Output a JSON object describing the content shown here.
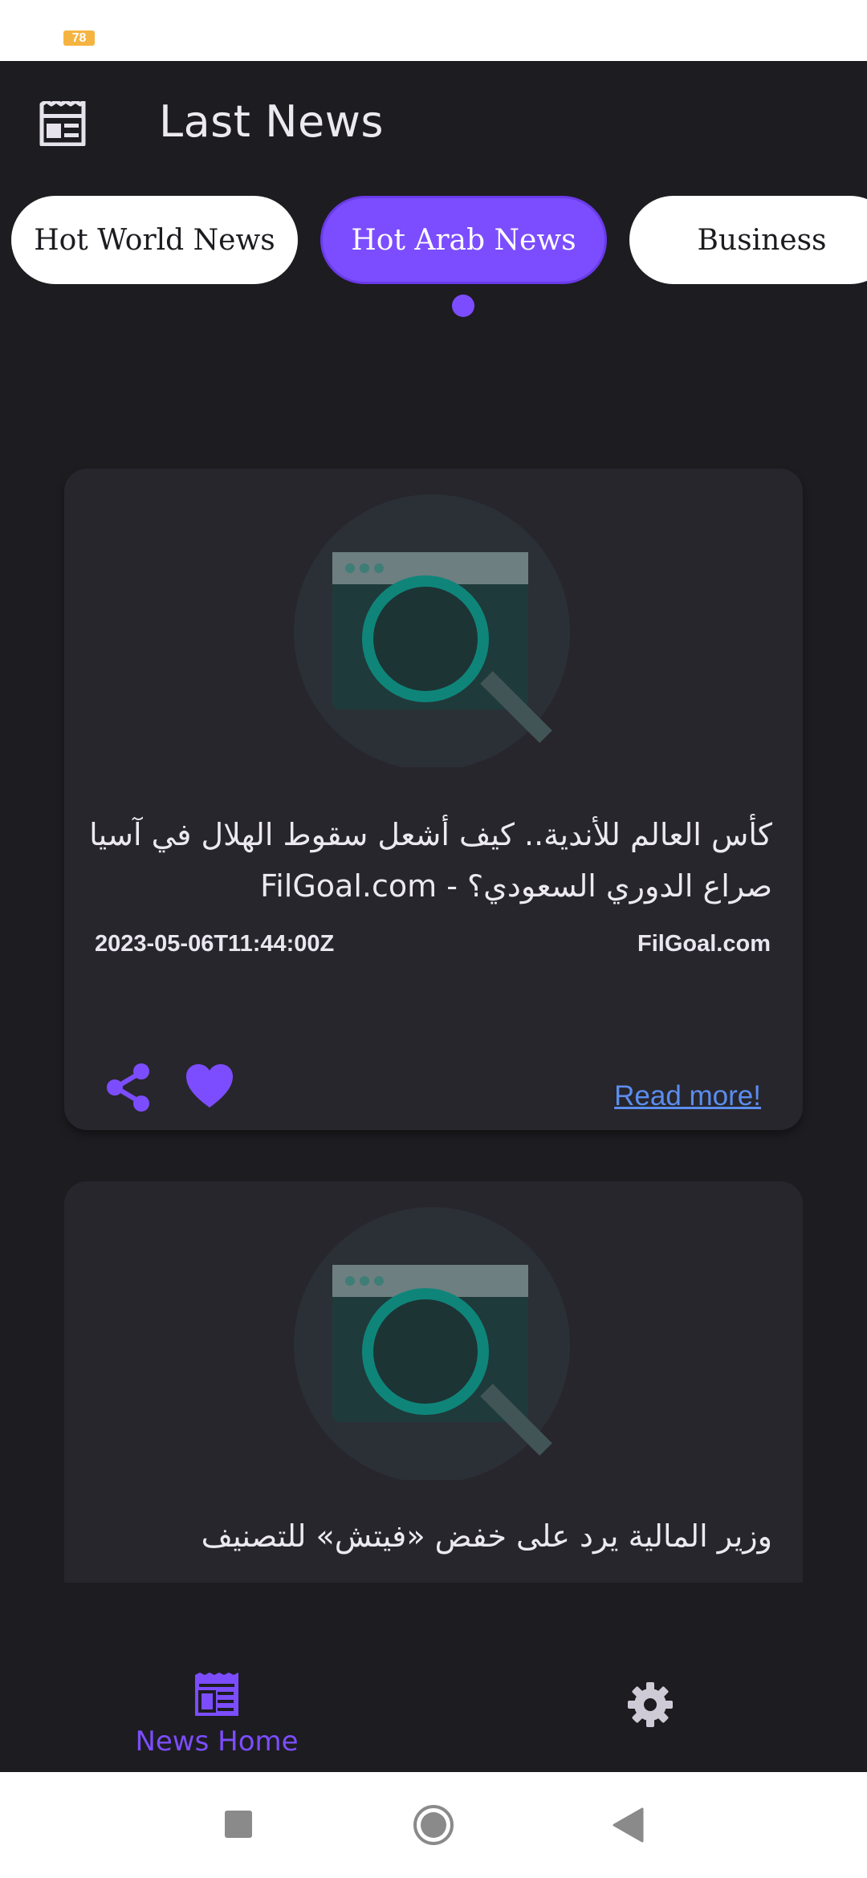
{
  "status_bar": {
    "battery": "78"
  },
  "app_bar": {
    "title": "Last News",
    "icon": "newspaper-icon"
  },
  "tabs": [
    {
      "label": "Hot World News",
      "active": false
    },
    {
      "label": "Hot Arab News",
      "active": true
    },
    {
      "label": "Business",
      "active": false
    }
  ],
  "articles": [
    {
      "headline": "كأس العالم للأندية.. كيف أشعل سقوط الهلال في آسيا صراع الدوري السعودي؟ - FilGoal.com",
      "date": "2023-05-06T11:44:00Z",
      "source": "FilGoal.com",
      "read_more": "Read more!",
      "image": "search-placeholder-illustration"
    },
    {
      "headline": "وزير المالية يرد على خفض «فيتش» للتصنيف",
      "image": "search-placeholder-illustration"
    }
  ],
  "bottom_nav": {
    "home_label": "News Home",
    "home_icon": "newspaper-icon",
    "settings_icon": "gear-icon"
  },
  "colors": {
    "accent": "#7c4dff",
    "background": "#1d1c21",
    "card": "#27262c",
    "link": "#5b8def"
  }
}
